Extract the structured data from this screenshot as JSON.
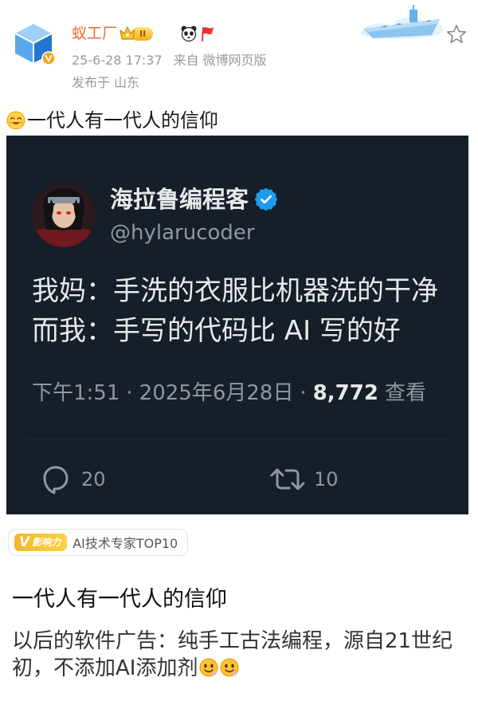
{
  "post": {
    "author_name": "蚁工厂",
    "level": "II",
    "time": "25-6-28 17:37",
    "source_prefix": "来自",
    "source": "微博网页版",
    "location_prefix": "发布于",
    "location": "山东",
    "headline": "一代人有一代人的信仰"
  },
  "tweet": {
    "author_name": "海拉鲁编程客",
    "handle": "@hylarucoder",
    "lines": [
      "我妈：手洗的衣服比机器洗的干净",
      "而我：手写的代码比 AI 写的好"
    ],
    "time": "下午1:51",
    "separator": "·",
    "date": "2025年6月28日",
    "views": "8,772",
    "views_label": "查看",
    "replies": "20",
    "retweets": "10"
  },
  "influence_badge": {
    "tag_letter": "V",
    "tag": "影响力",
    "label": "AI技术专家TOP10"
  },
  "article": {
    "title": "一代人有一代人的信仰",
    "body_lines": [
      "以后的软件广告：纯手工古法编程，源自21世纪",
      "初，不添加AI添加剂"
    ]
  },
  "icons": {
    "author_avatar": "cube-logo-avatar",
    "author_verified": "orange-verified-icon",
    "level_badge": "crown-icon",
    "badges": [
      "panda-icon",
      "red-flag-icon"
    ],
    "decoration": "aircraft-carrier-sticker",
    "favorite": "star-icon",
    "headline_emoji": "smile-emoji-icon",
    "tweet_verified": "blue-verified-icon",
    "reply": "reply-icon",
    "retweet": "retweet-icon",
    "body_emojis": [
      "grin-emoji-icon",
      "grin-emoji-icon"
    ]
  },
  "colors": {
    "author_name": "#ee6a2f",
    "tweet_background": "#151e29",
    "tweet_text": "#e7e9ea",
    "tweet_muted": "#8b98a5",
    "verified": "#1d9bf0",
    "meta_text": "#9a9a9a",
    "influence_tag": "#f6b42a"
  }
}
